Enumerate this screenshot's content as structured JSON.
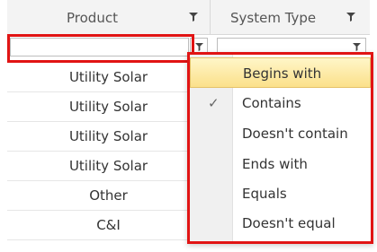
{
  "grid": {
    "columns": [
      {
        "key": "product",
        "label": "Product"
      },
      {
        "key": "system_type",
        "label": "System Type"
      }
    ],
    "filter": {
      "product_value": "",
      "system_type_value": ""
    },
    "rows": [
      {
        "product": "Utility Solar",
        "system_type": ""
      },
      {
        "product": "Utility Solar",
        "system_type": ""
      },
      {
        "product": "Utility Solar",
        "system_type": ""
      },
      {
        "product": "Utility Solar",
        "system_type": ""
      },
      {
        "product": "Other",
        "system_type": ""
      },
      {
        "product": "C&I",
        "system_type": ""
      }
    ]
  },
  "filter_menu": {
    "items": [
      {
        "label": "Begins with",
        "active": true,
        "checked": false
      },
      {
        "label": "Contains",
        "active": false,
        "checked": true
      },
      {
        "label": "Doesn't contain",
        "active": false,
        "checked": false
      },
      {
        "label": "Ends with",
        "active": false,
        "checked": false
      },
      {
        "label": "Equals",
        "active": false,
        "checked": false
      },
      {
        "label": "Doesn't equal",
        "active": false,
        "checked": false
      }
    ],
    "check_glyph": "✓"
  },
  "colors": {
    "highlight_border": "#e11414",
    "active_item": "#fbe08a"
  },
  "icons": {
    "header_filter": "funnel-icon",
    "filter_button": "funnel-icon",
    "check": "check-icon"
  }
}
